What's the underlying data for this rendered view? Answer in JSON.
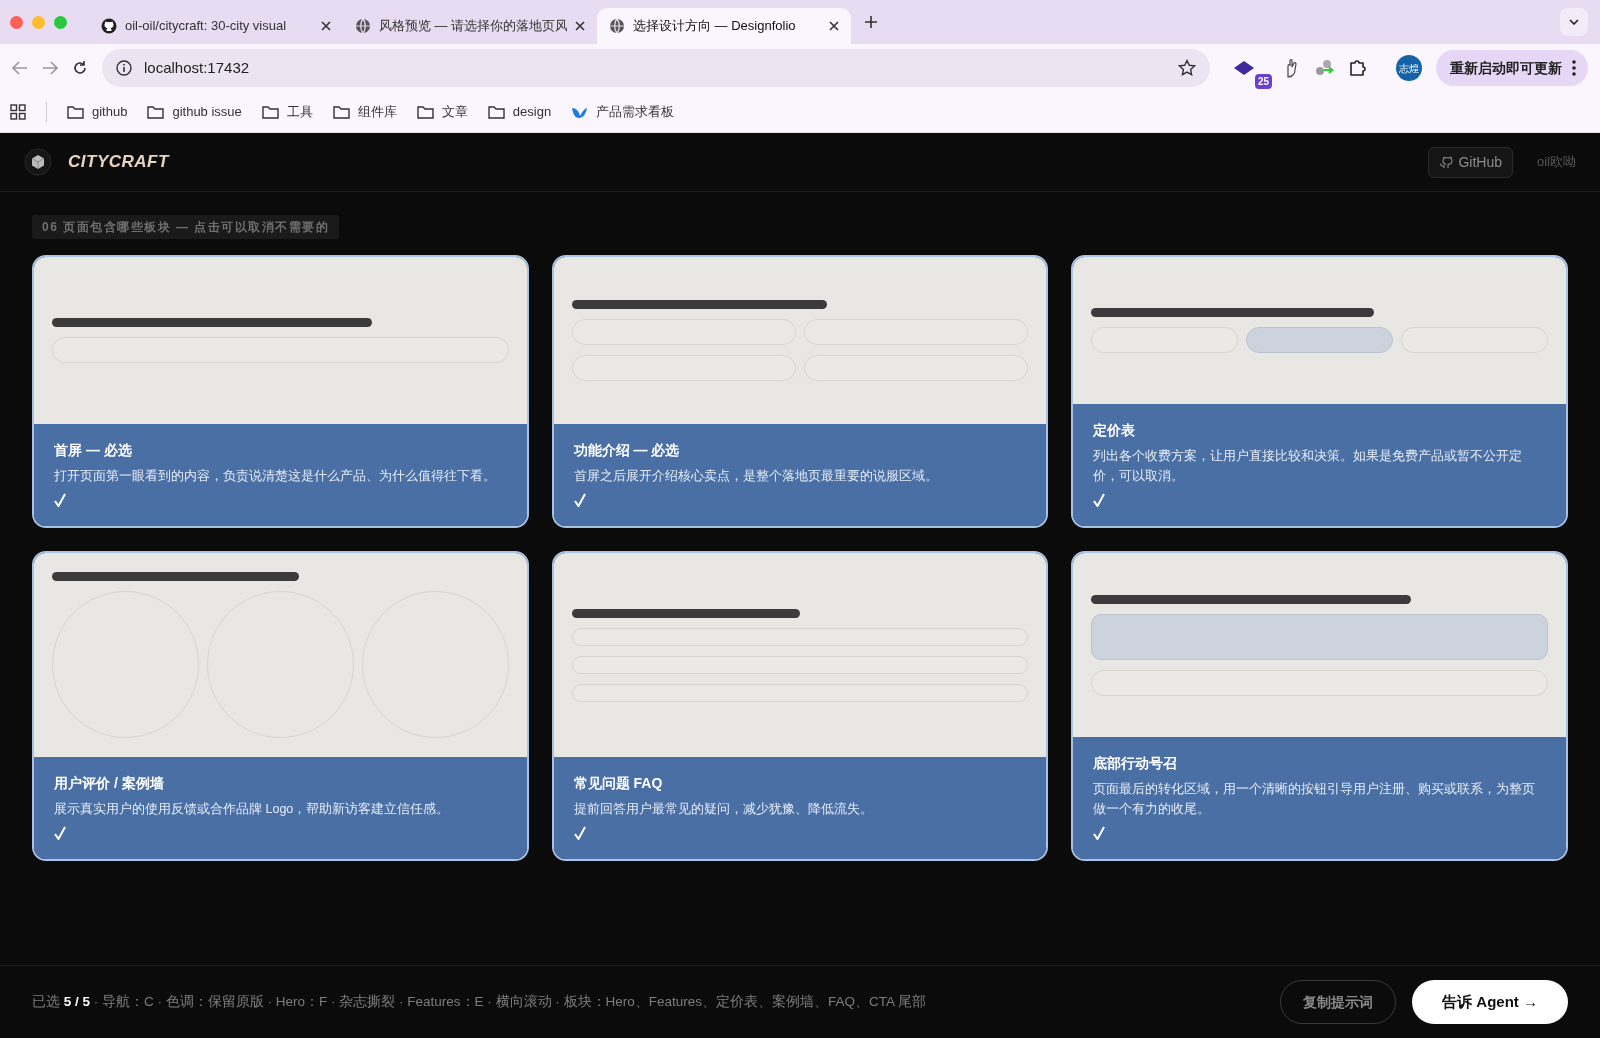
{
  "browser": {
    "tabs": [
      {
        "title": "oil-oil/citycraft: 30-city visual",
        "kind": "github",
        "selected": false
      },
      {
        "title": "风格预览 — 请选择你的落地页风",
        "kind": "globe",
        "selected": false
      },
      {
        "title": "选择设计方向 — Designfolio",
        "kind": "globe",
        "selected": true
      }
    ],
    "url": "localhost:17432",
    "extension_badge": "25",
    "profile": "志煌",
    "update_button": "重新启动即可更新",
    "bookmarks": [
      {
        "label": "github",
        "kind": "folder"
      },
      {
        "label": "github issue",
        "kind": "folder"
      },
      {
        "label": "工具",
        "kind": "folder"
      },
      {
        "label": "组件库",
        "kind": "folder"
      },
      {
        "label": "文章",
        "kind": "folder"
      },
      {
        "label": "design",
        "kind": "folder"
      },
      {
        "label": "产品需求看板",
        "kind": "app"
      }
    ]
  },
  "header": {
    "brand": "CITYCRAFT",
    "github_button": "GitHub",
    "user": "oil欧呦"
  },
  "step_label": "06 页面包含哪些板块 — 点击可以取消不需要的",
  "sections": [
    {
      "kind": "hero",
      "title": "首屏 — 必选",
      "description": "打开页面第一眼看到的内容，负责说清楚这是什么产品、为什么值得往下看。",
      "selected": true
    },
    {
      "kind": "features",
      "title": "功能介绍 — 必选",
      "description": "首屏之后展开介绍核心卖点，是整个落地页最重要的说服区域。",
      "selected": true
    },
    {
      "kind": "pricing",
      "title": "定价表",
      "description": "列出各个收费方案，让用户直接比较和决策。如果是免费产品或暂不公开定价，可以取消。",
      "selected": true
    },
    {
      "kind": "testimonials",
      "title": "用户评价 / 案例墙",
      "description": "展示真实用户的使用反馈或合作品牌 Logo，帮助新访客建立信任感。",
      "selected": true
    },
    {
      "kind": "faq",
      "title": "常见问题 FAQ",
      "description": "提前回答用户最常见的疑问，减少犹豫、降低流失。",
      "selected": true
    },
    {
      "kind": "cta",
      "title": "底部行动号召",
      "description": "页面最后的转化区域，用一个清晰的按钮引导用户注册、购买或联系，为整页做一个有力的收尾。",
      "selected": true
    }
  ],
  "footer": {
    "summary": "已选 **5 / 5** · 导航：C · 色调：保留原版 · Hero：F · 杂志撕裂 · Features：E · 横向滚动 · 板块：Hero、Features、定价表、案例墙、FAQ、CTA 尾部",
    "copy_button": "复制提示词",
    "agent_button": "告诉 Agent →"
  }
}
